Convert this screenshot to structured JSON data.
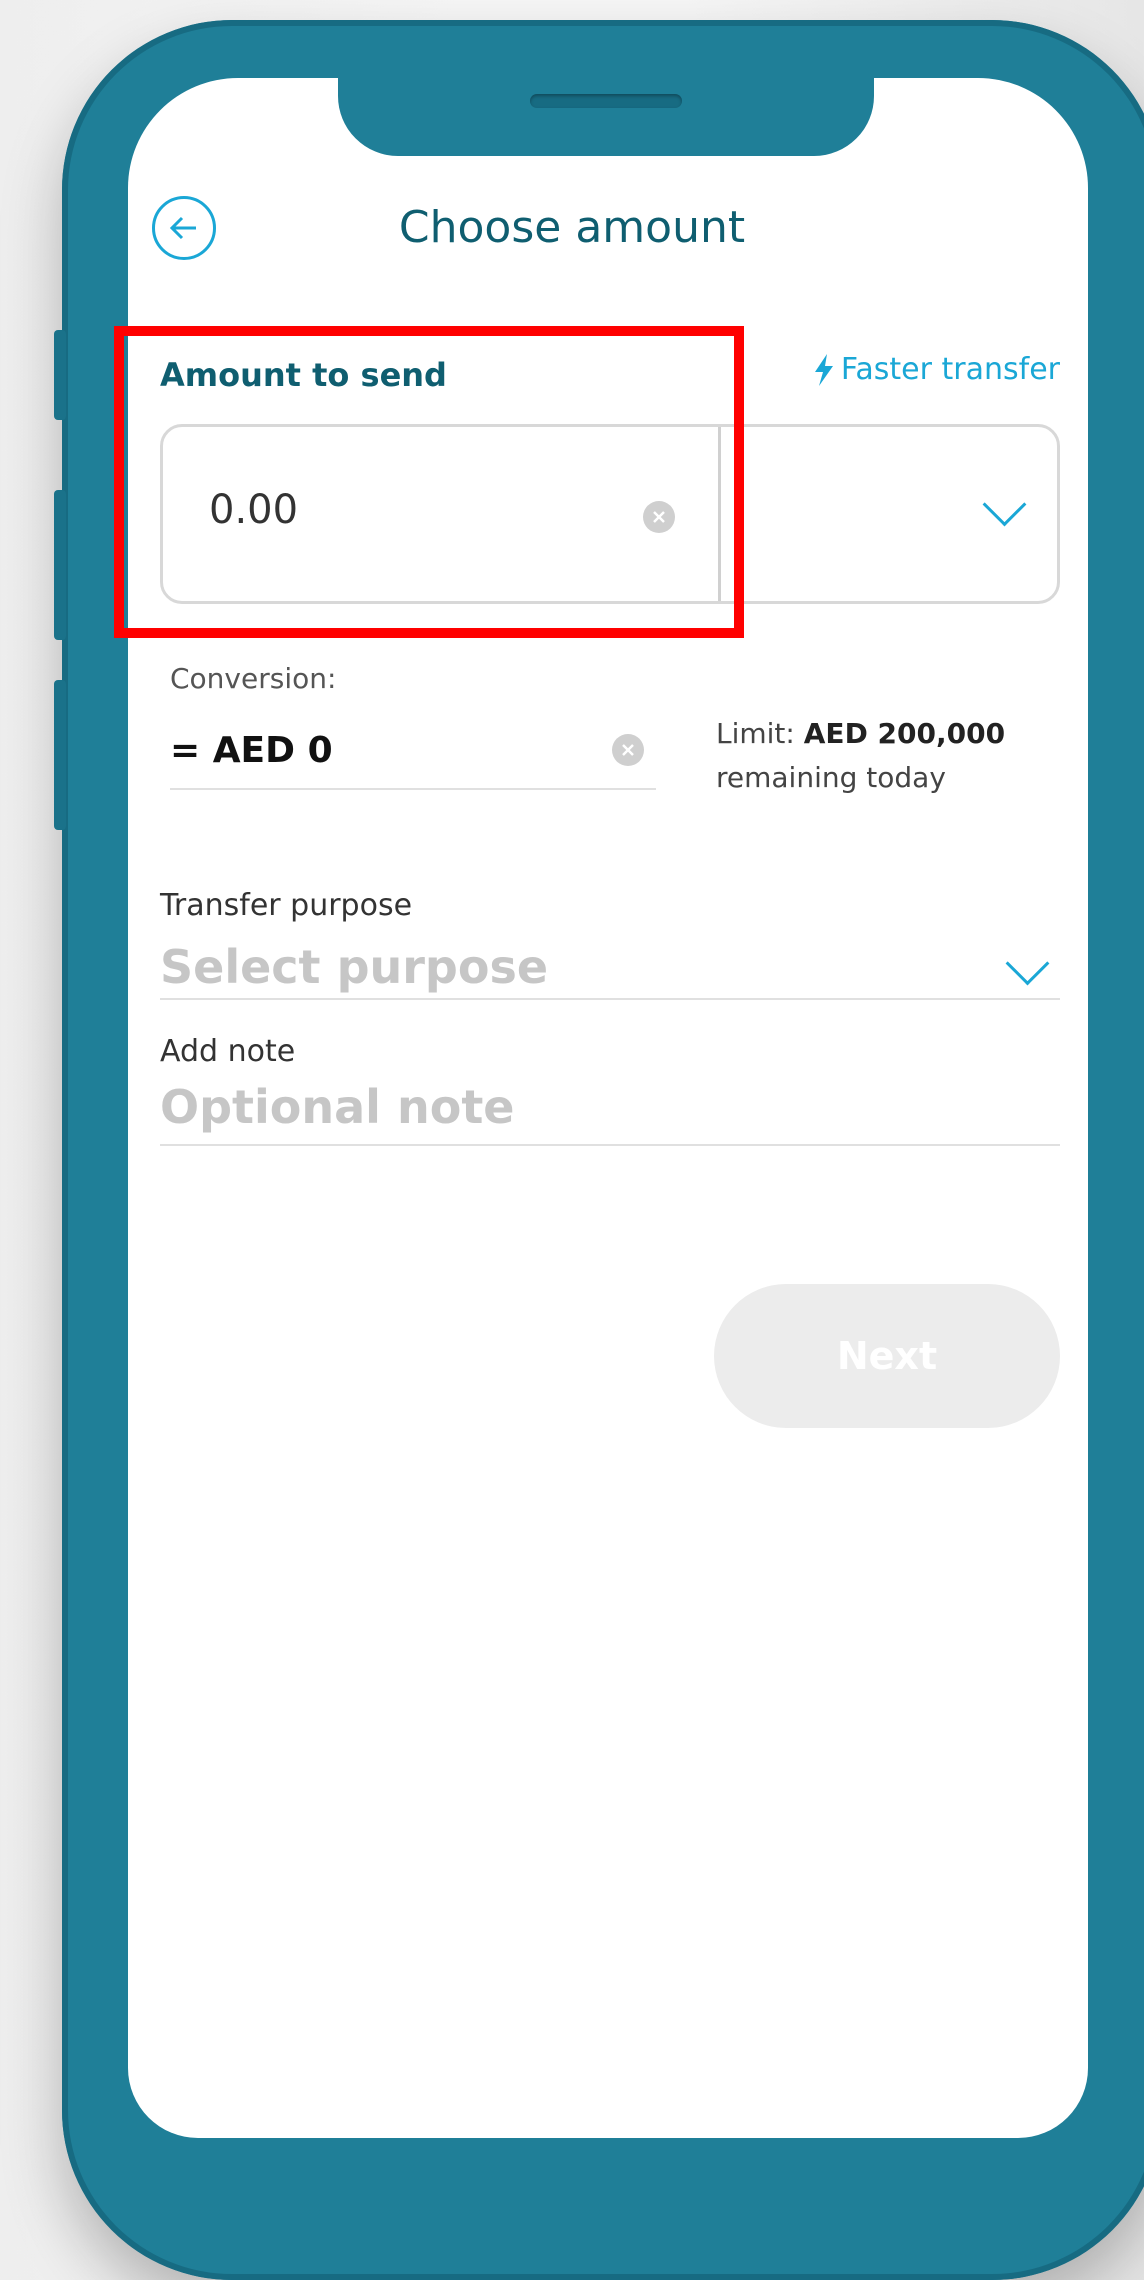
{
  "header": {
    "title": "Choose amount"
  },
  "amount": {
    "label": "Amount to send",
    "faster_transfer": "Faster transfer",
    "value": "0.00"
  },
  "conversion": {
    "label": "Conversion:",
    "value": "= AED 0",
    "limit_prefix": "Limit:",
    "limit_amount": "AED 200,000",
    "limit_suffix": "remaining today"
  },
  "purpose": {
    "label": "Transfer purpose",
    "placeholder": "Select purpose"
  },
  "note": {
    "label": "Add note",
    "placeholder": "Optional note"
  },
  "actions": {
    "next": "Next"
  },
  "colors": {
    "accent": "#1aa7d6",
    "brand": "#1f7f98",
    "heading": "#0f5e70",
    "highlight": "#ff0000"
  }
}
